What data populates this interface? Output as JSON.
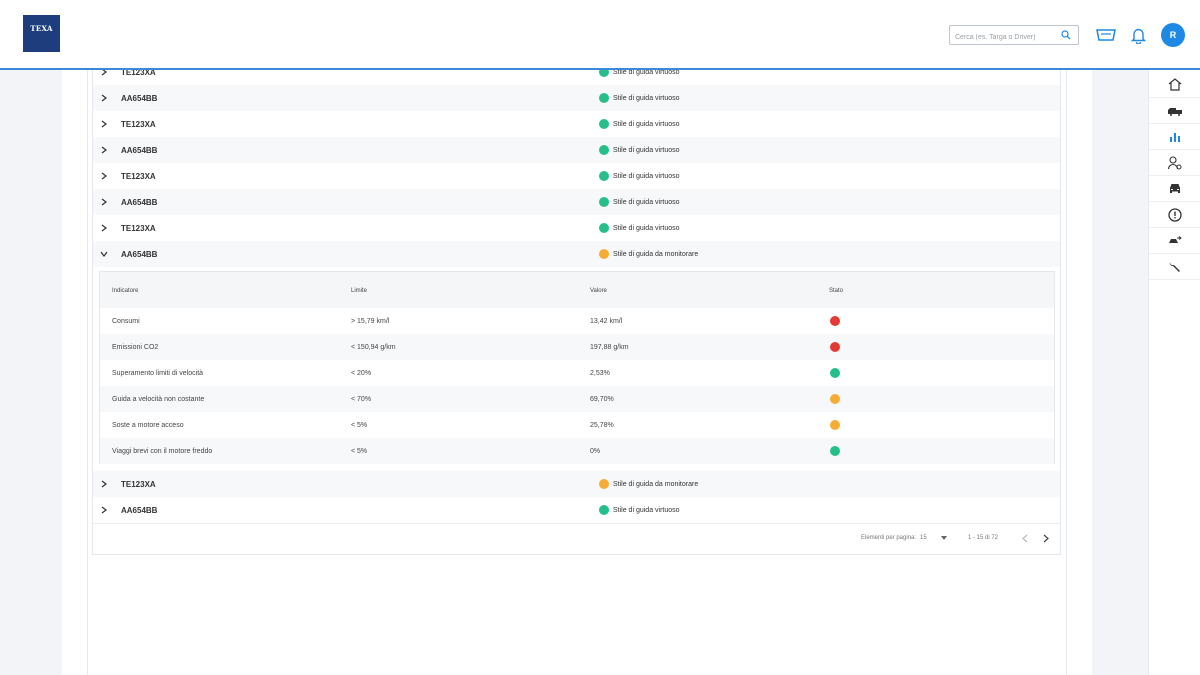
{
  "header": {
    "logo_text": "TEXA",
    "search_placeholder": "Cerca (es. Targa o Driver)",
    "avatar_initial": "R"
  },
  "vehicles_top": [
    {
      "plate": "TE123XA",
      "status": "Stile di guida virtuoso",
      "color": "#25c08a"
    },
    {
      "plate": "AA654BB",
      "status": "Stile di guida virtuoso",
      "color": "#25c08a"
    },
    {
      "plate": "TE123XA",
      "status": "Stile di guida virtuoso",
      "color": "#25c08a"
    },
    {
      "plate": "AA654BB",
      "status": "Stile di guida virtuoso",
      "color": "#25c08a"
    },
    {
      "plate": "TE123XA",
      "status": "Stile di guida virtuoso",
      "color": "#25c08a"
    },
    {
      "plate": "AA654BB",
      "status": "Stile di guida virtuoso",
      "color": "#25c08a"
    },
    {
      "plate": "TE123XA",
      "status": "Stile di guida virtuoso",
      "color": "#25c08a"
    }
  ],
  "expanded": {
    "plate": "AA654BB",
    "status": "Stile di guida da monitorare",
    "color": "#f5ad35",
    "columns": [
      "Indicatore",
      "Limite",
      "Valore",
      "Stato"
    ],
    "rows": [
      {
        "indicator": "Consumi",
        "limit": "> 15,79 km/l",
        "value": "13,42 km/l",
        "state": "#e53935"
      },
      {
        "indicator": "Emissioni CO2",
        "limit": "< 150,94 g/km",
        "value": "197,88 g/km",
        "state": "#e53935"
      },
      {
        "indicator": "Superamento limiti di velocità",
        "limit": "< 20%",
        "value": "2,53%",
        "state": "#25c08a"
      },
      {
        "indicator": "Guida a velocità non costante",
        "limit": "< 70%",
        "value": "69,70%",
        "state": "#f5ad35"
      },
      {
        "indicator": "Soste a motore acceso",
        "limit": "< 5%",
        "value": "25,78%",
        "state": "#f5ad35"
      },
      {
        "indicator": "Viaggi brevi con il motore freddo",
        "limit": "< 5%",
        "value": "0%",
        "state": "#25c08a"
      }
    ]
  },
  "vehicles_bottom": [
    {
      "plate": "TE123XA",
      "status": "Stile di guida da monitorare",
      "color": "#f5ad35"
    },
    {
      "plate": "AA654BB",
      "status": "Stile di guida virtuoso",
      "color": "#25c08a"
    }
  ],
  "pagination": {
    "per_page_label": "Elementi per pagina:",
    "per_page_value": "15",
    "range": "1 - 15 di 72"
  },
  "nav_icons": [
    "home-icon",
    "fleet-icon",
    "chart-icon",
    "driver-icon",
    "car-icon",
    "alert-icon",
    "vehicle-move-icon",
    "wrench-icon"
  ]
}
